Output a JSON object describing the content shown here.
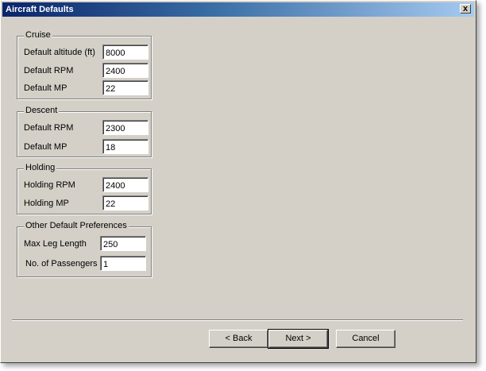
{
  "window": {
    "title": "Aircraft Defaults",
    "close_label": "x"
  },
  "cruise": {
    "legend": "Cruise",
    "altitude_label": "Default altitude (ft)",
    "altitude_value": "8000",
    "rpm_label": "Default RPM",
    "rpm_value": "2400",
    "mp_label": "Default MP",
    "mp_value": "22"
  },
  "descent": {
    "legend": "Descent",
    "rpm_label": "Default RPM",
    "rpm_value": "2300",
    "mp_label": "Default MP",
    "mp_value": "18"
  },
  "holding": {
    "legend": "Holding",
    "rpm_label": "Holding RPM",
    "rpm_value": "2400",
    "mp_label": "Holding MP",
    "mp_value": "22"
  },
  "other": {
    "legend": "Other Default Preferences",
    "leg_label": "Max Leg Length",
    "leg_value": "250",
    "pax_label": "No. of Passengers",
    "pax_value": "1"
  },
  "buttons": {
    "back": "< Back",
    "next": "Next >",
    "cancel": "Cancel"
  }
}
